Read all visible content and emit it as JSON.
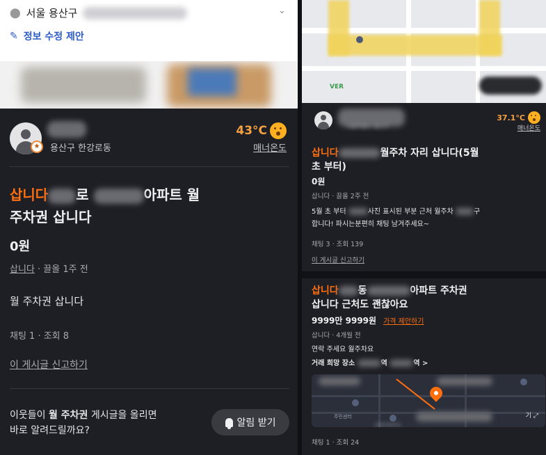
{
  "left": {
    "address": {
      "district": "서울 용산구"
    },
    "edit_suggestion": "정보 수정 제안",
    "seller": {
      "location": "용산구 한강로동",
      "temperature": "43°C",
      "manner_label": "매너온도"
    },
    "post": {
      "title_prefix": "삽니다",
      "title_mid": "로",
      "title_suffix": "아파트 월",
      "title_line2": "주차권 삽니다",
      "price": "0원",
      "category": "삽니다",
      "bumped": "· 끌올 1주 전",
      "description": "월 주차권 삽니다",
      "stats": "채팅 1 · 조회 8",
      "report": "이 게시글 신고하기"
    },
    "notify": {
      "line1_pre": "이웃들이 ",
      "keyword": "월 주차권",
      "line1_post": " 게시글을 올리면",
      "line2": "바로 알려드릴까요?",
      "button": "알림 받기"
    }
  },
  "right": {
    "map_logo": "VER",
    "seller": {
      "sub": "서울특별시 용산구",
      "temperature": "37.1°C",
      "manner_label": "매너온도"
    },
    "post1": {
      "title_prefix": "삽니다",
      "title_rest": "월주차 자리 삽니다(5월",
      "title_line2": "초 부터)",
      "price": "0원",
      "meta": "삽니다 · 끌올 2주 전",
      "desc_line1_a": "5월 초 부터",
      "desc_line1_b": "사진 표시된 부분 근처 월주차",
      "desc_line1_c": "구",
      "desc_line2_a": "합니다! 파시는분",
      "desc_line2_b": "편히 채팅 남겨주세요~",
      "stats": "채팅 3 · 조회 139",
      "report": "이 게시글 신고하기"
    },
    "post2": {
      "title_prefix": "삽니다",
      "title_a": "동",
      "title_b": "아파트 주차권",
      "title_line2": "삽니다 근처도 괜찮아요",
      "price": "9999만 9999원",
      "offer": "가격 제안하기",
      "meta": "삽니다 · 4개월 전",
      "desc": "연락 주세요 월주차요",
      "place_label": "거래 희망 장소",
      "place_a": "역",
      "place_b": "역 >",
      "map_label1": "주민센터",
      "map_label2": "신용초등학교",
      "map_expand": "기 ⤢",
      "stats": "채팅 1 · 조회 24"
    }
  }
}
